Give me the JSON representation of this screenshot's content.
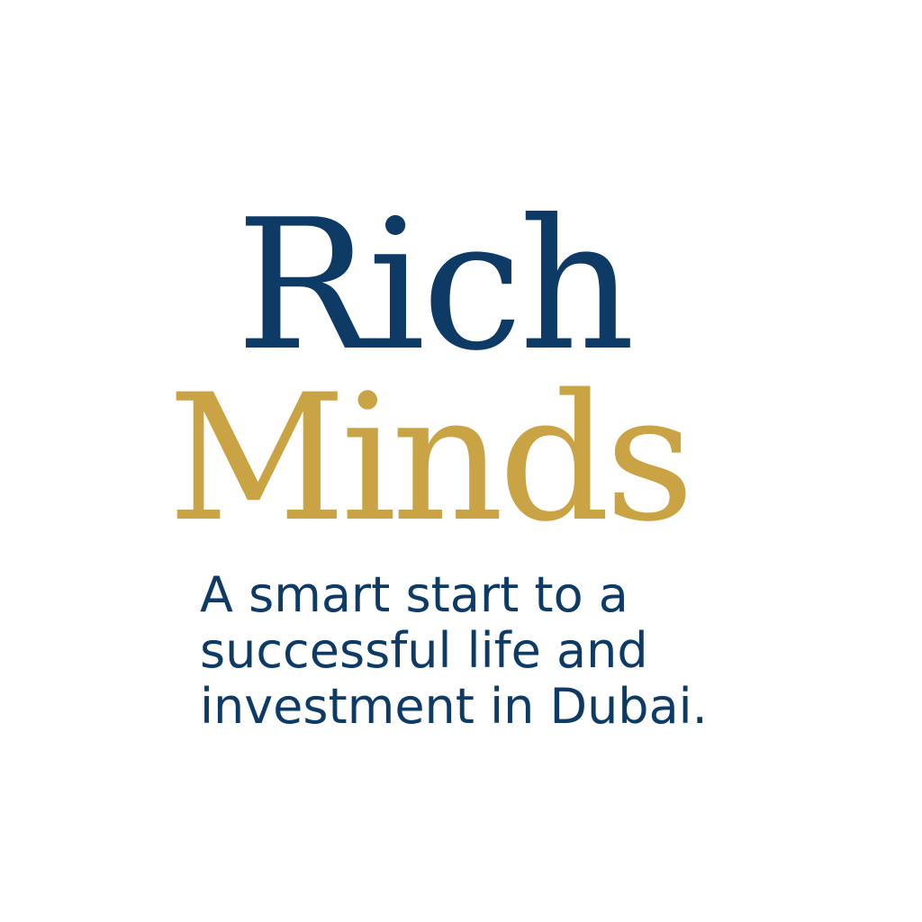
{
  "logo": {
    "word_primary": "Rich",
    "word_secondary": "Minds",
    "tagline": [
      "A smart start to a",
      "successful life and",
      "investment in Dubai."
    ]
  },
  "colors": {
    "navy": "#0e3a66",
    "gold": "#c9a344",
    "background": "#ffffff"
  }
}
